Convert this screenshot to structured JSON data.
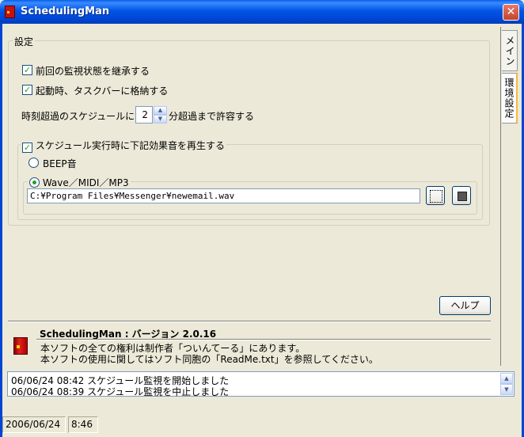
{
  "window": {
    "title": "SchedulingMan",
    "close_glyph": "✕"
  },
  "tabs": [
    {
      "label": "メイン"
    },
    {
      "label": "環境設定"
    }
  ],
  "settings": {
    "group_label": "設定",
    "inherit_monitor": {
      "label": "前回の監視状態を継承する",
      "checked": true
    },
    "store_in_tray": {
      "label": "起動時、タスクバーに格納する",
      "checked": true
    },
    "overdue": {
      "prefix": "時刻超過のスケジュールには",
      "value": "2",
      "suffix": "分超過まで許容する"
    },
    "sound": {
      "label": "スケジュール実行時に下記効果音を再生する",
      "checked": true,
      "beep_label": "BEEP音",
      "wave_label": "Wave／MIDI／MP3",
      "selected": "wave",
      "file_path": "C:¥Program Files¥Messenger¥newemail.wav"
    },
    "help_button": "ヘルプ"
  },
  "about": {
    "title": "SchedulingMan : バージョン 2.0.16",
    "line1": "本ソフトの全ての権利は制作者「ついんてーる」にあります。",
    "line2": "本ソフトの使用に関してはソフト同胞の「ReadMe.txt」を参照してください。"
  },
  "log": [
    "06/06/24 08:42 スケジュール監視を開始しました",
    "06/06/24 08:39 スケジュール監視を中止しました"
  ],
  "status": {
    "date": "2006/06/24",
    "time": "8:46"
  },
  "icons": {
    "app": "door-icon",
    "browse": "browse-icon",
    "stop": "stop-icon"
  },
  "colors": {
    "titlebar": "#0055E5",
    "face": "#ECE9D8",
    "check": "#21A121"
  }
}
